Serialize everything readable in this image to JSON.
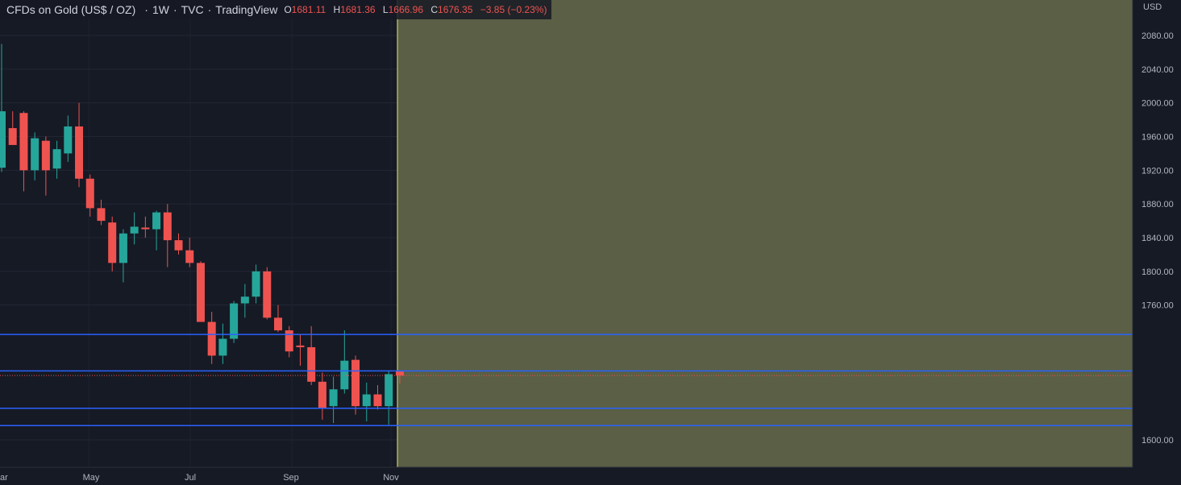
{
  "header": {
    "symbol": "CFDs on Gold (US$ / OZ)",
    "interval": "1W",
    "exchange": "TVC",
    "source": "TradingView",
    "ohlc": {
      "o_label": "O",
      "o": "1681.11",
      "h_label": "H",
      "h": "1681.36",
      "l_label": "L",
      "l": "1666.96",
      "c_label": "C",
      "c": "1676.35",
      "change": "−3.85 (−0.23%)"
    }
  },
  "colors": {
    "background": "#161a25",
    "bull": "#26a69a",
    "bear": "#ef5350",
    "hline": "#2962ff",
    "zone": "#5a5f45",
    "now_line": "#e6e76a",
    "axis_text": "#b2b5be"
  },
  "chart_data": {
    "type": "candlestick",
    "y_unit": "USD",
    "ylim": [
      1580,
      2120
    ],
    "y_ticks": [
      "2080.00",
      "2040.00",
      "2000.00",
      "1960.00",
      "1920.00",
      "1880.00",
      "1840.00",
      "1800.00",
      "1760.00",
      "1600.00"
    ],
    "x_labels": [
      "ar",
      "May",
      "Jul",
      "Sep",
      "Nov"
    ],
    "candles": [
      {
        "o": 1923,
        "h": 2070,
        "l": 1918,
        "c": 1990
      },
      {
        "o": 1970,
        "h": 1990,
        "l": 1965,
        "c": 1950
      },
      {
        "o": 1988,
        "h": 1990,
        "l": 1895,
        "c": 1920
      },
      {
        "o": 1920,
        "h": 1965,
        "l": 1908,
        "c": 1958
      },
      {
        "o": 1955,
        "h": 1960,
        "l": 1890,
        "c": 1920
      },
      {
        "o": 1922,
        "h": 1955,
        "l": 1910,
        "c": 1945
      },
      {
        "o": 1940,
        "h": 1985,
        "l": 1930,
        "c": 1972
      },
      {
        "o": 1972,
        "h": 2000,
        "l": 1900,
        "c": 1910
      },
      {
        "o": 1910,
        "h": 1915,
        "l": 1865,
        "c": 1875
      },
      {
        "o": 1875,
        "h": 1885,
        "l": 1855,
        "c": 1860
      },
      {
        "o": 1858,
        "h": 1865,
        "l": 1800,
        "c": 1810
      },
      {
        "o": 1810,
        "h": 1850,
        "l": 1787,
        "c": 1845
      },
      {
        "o": 1845,
        "h": 1870,
        "l": 1832,
        "c": 1853
      },
      {
        "o": 1852,
        "h": 1865,
        "l": 1840,
        "c": 1850
      },
      {
        "o": 1850,
        "h": 1872,
        "l": 1825,
        "c": 1870
      },
      {
        "o": 1870,
        "h": 1880,
        "l": 1805,
        "c": 1837
      },
      {
        "o": 1837,
        "h": 1845,
        "l": 1820,
        "c": 1825
      },
      {
        "o": 1825,
        "h": 1840,
        "l": 1805,
        "c": 1810
      },
      {
        "o": 1810,
        "h": 1812,
        "l": 1780,
        "c": 1740
      },
      {
        "o": 1740,
        "h": 1752,
        "l": 1690,
        "c": 1700
      },
      {
        "o": 1700,
        "h": 1738,
        "l": 1690,
        "c": 1720
      },
      {
        "o": 1720,
        "h": 1765,
        "l": 1715,
        "c": 1762
      },
      {
        "o": 1762,
        "h": 1785,
        "l": 1745,
        "c": 1770
      },
      {
        "o": 1770,
        "h": 1808,
        "l": 1762,
        "c": 1800
      },
      {
        "o": 1800,
        "h": 1805,
        "l": 1743,
        "c": 1745
      },
      {
        "o": 1745,
        "h": 1760,
        "l": 1728,
        "c": 1730
      },
      {
        "o": 1730,
        "h": 1735,
        "l": 1698,
        "c": 1705
      },
      {
        "o": 1712,
        "h": 1725,
        "l": 1688,
        "c": 1710
      },
      {
        "o": 1710,
        "h": 1735,
        "l": 1665,
        "c": 1669
      },
      {
        "o": 1669,
        "h": 1680,
        "l": 1624,
        "c": 1638
      },
      {
        "o": 1640,
        "h": 1675,
        "l": 1620,
        "c": 1660
      },
      {
        "o": 1660,
        "h": 1730,
        "l": 1655,
        "c": 1694
      },
      {
        "o": 1695,
        "h": 1700,
        "l": 1630,
        "c": 1640
      },
      {
        "o": 1640,
        "h": 1668,
        "l": 1622,
        "c": 1654
      },
      {
        "o": 1654,
        "h": 1665,
        "l": 1636,
        "c": 1640
      },
      {
        "o": 1640,
        "h": 1682,
        "l": 1618,
        "c": 1678
      },
      {
        "o": 1681.11,
        "h": 1681.36,
        "l": 1666.96,
        "c": 1676.35
      }
    ],
    "horizontal_lines": [
      {
        "price": 1725.1,
        "label": "1725.10"
      },
      {
        "price": 1681.85,
        "label": "1681.85"
      },
      {
        "price": 1637.58,
        "label": "1637.58"
      },
      {
        "price": 1616.98,
        "label": "1616.98"
      }
    ],
    "last_price": {
      "price": 1676.35,
      "label": "1676.35"
    },
    "future_zone": "shaded area after last bar"
  }
}
